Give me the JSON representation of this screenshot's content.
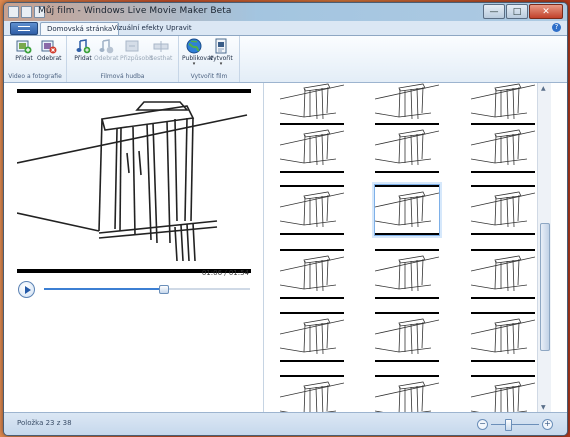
{
  "window": {
    "title": "Můj film - Windows Live Movie Maker Beta",
    "minimize": "—",
    "maximize": "□",
    "close": "✕"
  },
  "tabs": [
    {
      "label": "Domovská stránka",
      "active": true
    },
    {
      "label": "Vizuální efekty",
      "active": false
    },
    {
      "label": "Upravit",
      "active": false
    }
  ],
  "help": "?",
  "ribbon": {
    "groups": [
      {
        "label": "Video a fotografie",
        "buttons": [
          {
            "label": "Přidat",
            "icon": "add-video-icon",
            "disabled": false
          },
          {
            "label": "Odebrat",
            "icon": "remove-video-icon",
            "disabled": false
          }
        ]
      },
      {
        "label": "Filmová hudba",
        "buttons": [
          {
            "label": "Přidat",
            "icon": "add-music-icon",
            "disabled": false
          },
          {
            "label": "Odebrat",
            "icon": "remove-music-icon",
            "disabled": true
          },
          {
            "label": "Přizpůsobit",
            "icon": "fit-icon",
            "disabled": true
          },
          {
            "label": "Sesthat",
            "icon": "snap-icon",
            "disabled": true
          }
        ]
      },
      {
        "label": "Vytvořit film",
        "buttons": [
          {
            "label": "Publikovat",
            "icon": "globe-icon",
            "disabled": false,
            "dropdown": true
          },
          {
            "label": "Vytvořit",
            "icon": "create-movie-icon",
            "disabled": false,
            "dropdown": true
          }
        ]
      }
    ]
  },
  "preview": {
    "time": "01:06 / 01:54",
    "progress": 0.578
  },
  "storyboard": {
    "selected_index": 7,
    "tiles": 18
  },
  "status": {
    "text": "Položka 23 z 38"
  },
  "zoom": {
    "minus": "−",
    "plus": "+",
    "level": 0.3
  },
  "colors": {
    "accent": "#3c7fd3",
    "window_frame": "#bcd2e8",
    "selection": "#7eb0e8"
  }
}
